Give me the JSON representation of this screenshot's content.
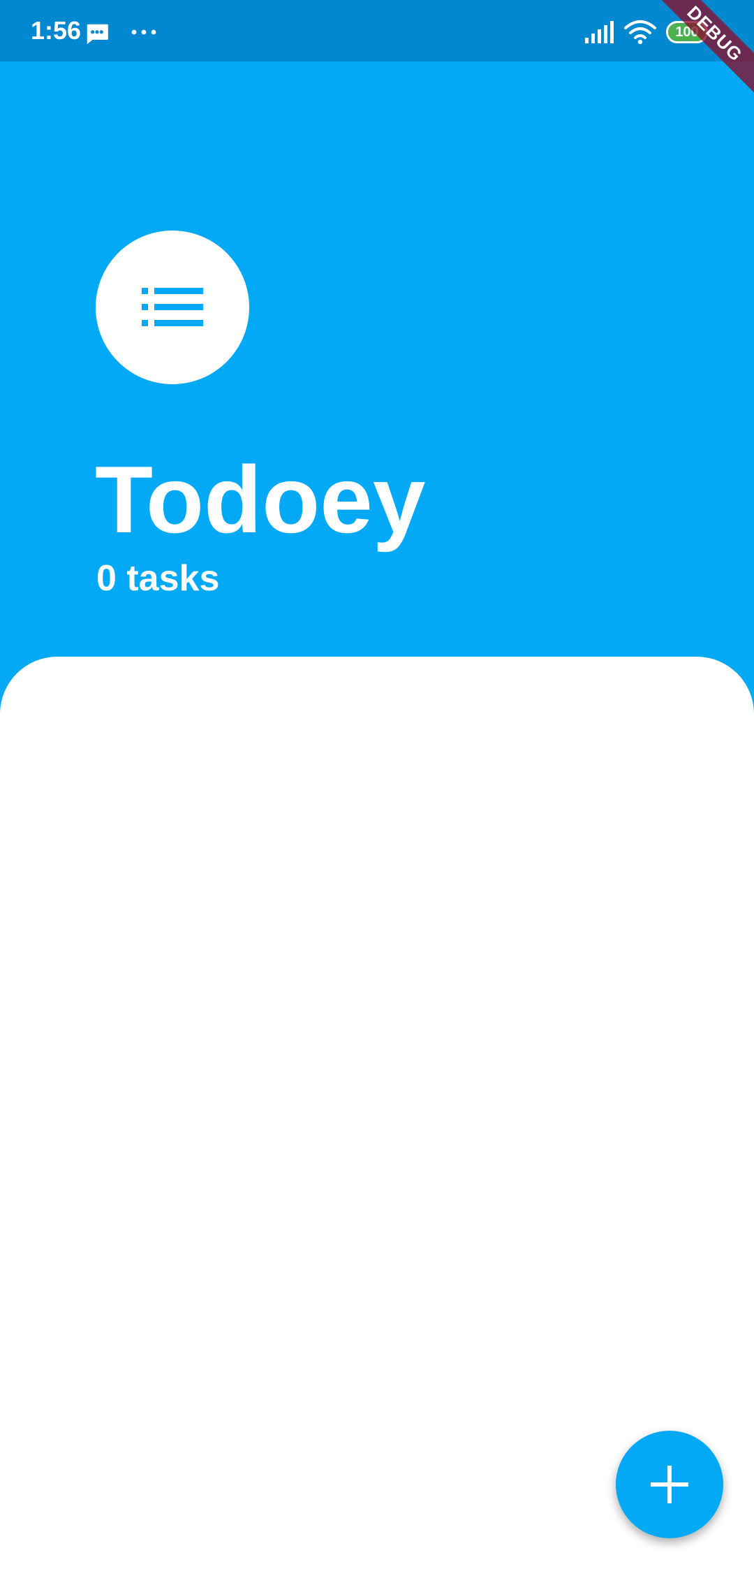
{
  "status_bar": {
    "time": "1:56",
    "battery_level": "100",
    "icons": [
      "message-icon",
      "more-icon",
      "signal-icon",
      "wifi-icon",
      "battery-icon"
    ]
  },
  "debug_banner": {
    "label": "DEBUG"
  },
  "header": {
    "app_icon": "list-icon",
    "title": "Todoey",
    "task_count": "0 tasks"
  },
  "task_list": {
    "items": []
  },
  "fab": {
    "icon": "plus-icon"
  },
  "colors": {
    "primary": "#03A9F4",
    "status_bar": "#0288D1",
    "surface": "#FFFFFF",
    "battery": "#4CAF50",
    "debug_banner": "#880E2C"
  }
}
